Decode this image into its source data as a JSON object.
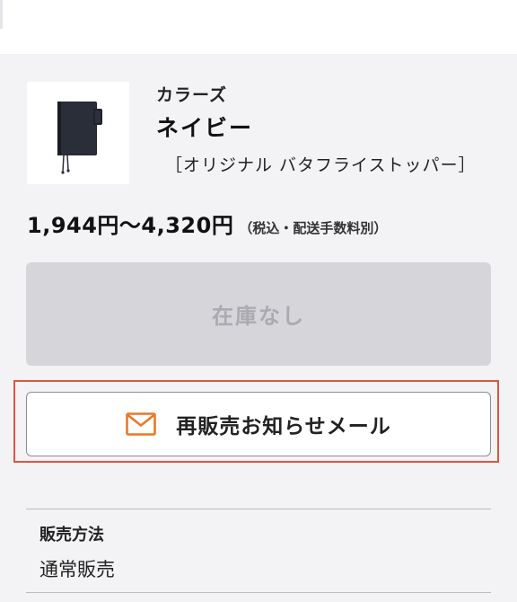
{
  "product": {
    "category": "カラーズ",
    "color_name": "ネイビー",
    "variant": "［オリジナル バタフライストッパー］",
    "image": "navy-notebook-cover"
  },
  "price": {
    "range": "1,944円〜4,320円",
    "note": "（税込・配送手数料別）"
  },
  "stock": {
    "status_label": "在庫なし"
  },
  "notify": {
    "label": "再販売お知らせメール",
    "icon": "mail-icon",
    "icon_color": "#e8782a",
    "highlight_color": "#e2553e"
  },
  "sales_method": {
    "heading": "販売方法",
    "value": "通常販売"
  }
}
